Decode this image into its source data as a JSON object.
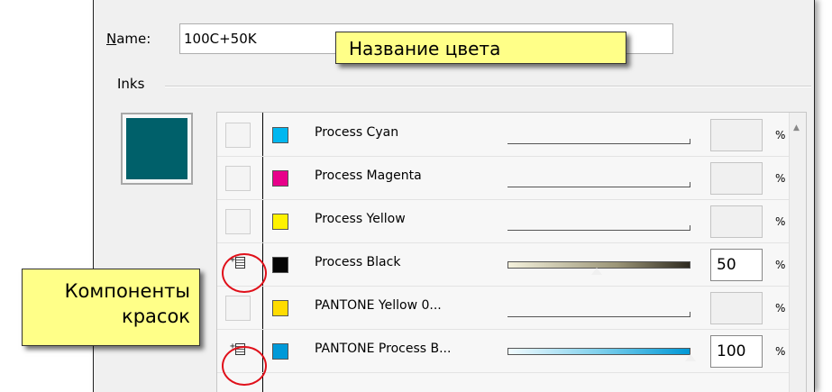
{
  "name_field": {
    "label": "Name:",
    "label_first": "N",
    "label_rest": "ame:",
    "value": "100C+50K"
  },
  "inks": {
    "label": "Inks",
    "preview_color": "#00606a",
    "rows": [
      {
        "name": "Process Cyan",
        "color": "#00b7f0",
        "value": "",
        "component": false
      },
      {
        "name": "Process Magenta",
        "color": "#e8008a",
        "value": "",
        "component": false
      },
      {
        "name": "Process Yellow",
        "color": "#fff200",
        "value": "",
        "component": false
      },
      {
        "name": "Process Black",
        "color": "#050505",
        "value": "50",
        "component": true
      },
      {
        "name": "PANTONE Yellow 0...",
        "color": "#ffdc00",
        "value": "",
        "component": false
      },
      {
        "name": "PANTONE Process B...",
        "color": "#0099d8",
        "value": "100",
        "component": true
      }
    ],
    "percent_sign": "%"
  },
  "callouts": {
    "color_name": "Название цвета",
    "components_line1": "Компоненты",
    "components_line2": "красок"
  }
}
